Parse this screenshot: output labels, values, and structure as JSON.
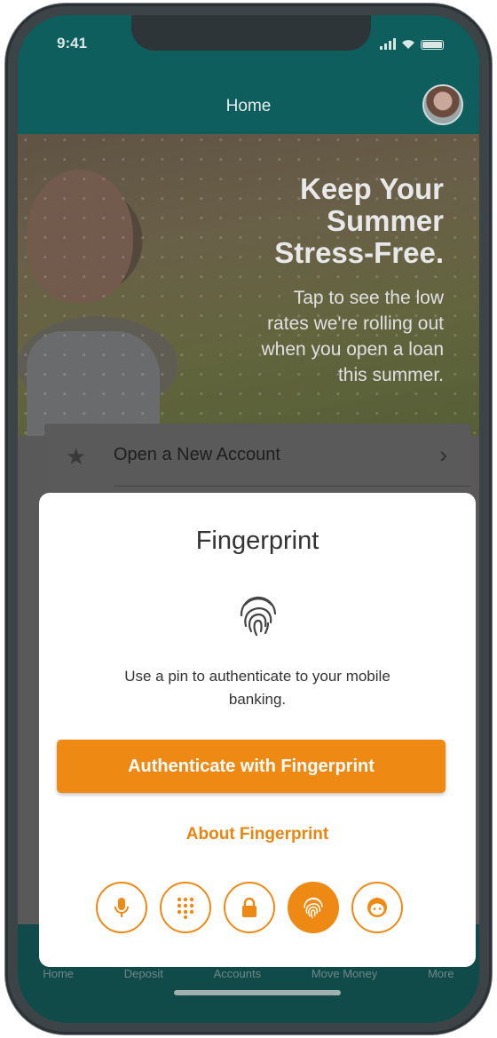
{
  "status_bar": {
    "time": "9:41"
  },
  "header": {
    "title": "Home"
  },
  "banner": {
    "headline": "Keep Your\nSummer\nStress-Free.",
    "subtext": "Tap to see the low\nrates we're rolling out\nwhen you open a loan\nthis summer."
  },
  "account_card": {
    "label": "Open a New Account"
  },
  "modal": {
    "title": "Fingerprint",
    "description": "Use a pin to authenticate to your mobile banking.",
    "primary_button": "Authenticate with Fingerprint",
    "link": "About Fingerprint",
    "methods": [
      {
        "icon": "microphone-icon",
        "active": false
      },
      {
        "icon": "keypad-icon",
        "active": false
      },
      {
        "icon": "lock-icon",
        "active": false
      },
      {
        "icon": "fingerprint-icon",
        "active": true
      },
      {
        "icon": "face-icon",
        "active": false
      }
    ]
  },
  "bottom_nav": [
    "Home",
    "Deposit",
    "Accounts",
    "Move Money",
    "More"
  ],
  "colors": {
    "accent": "#ee8a14",
    "brand": "#0d5e5c"
  }
}
